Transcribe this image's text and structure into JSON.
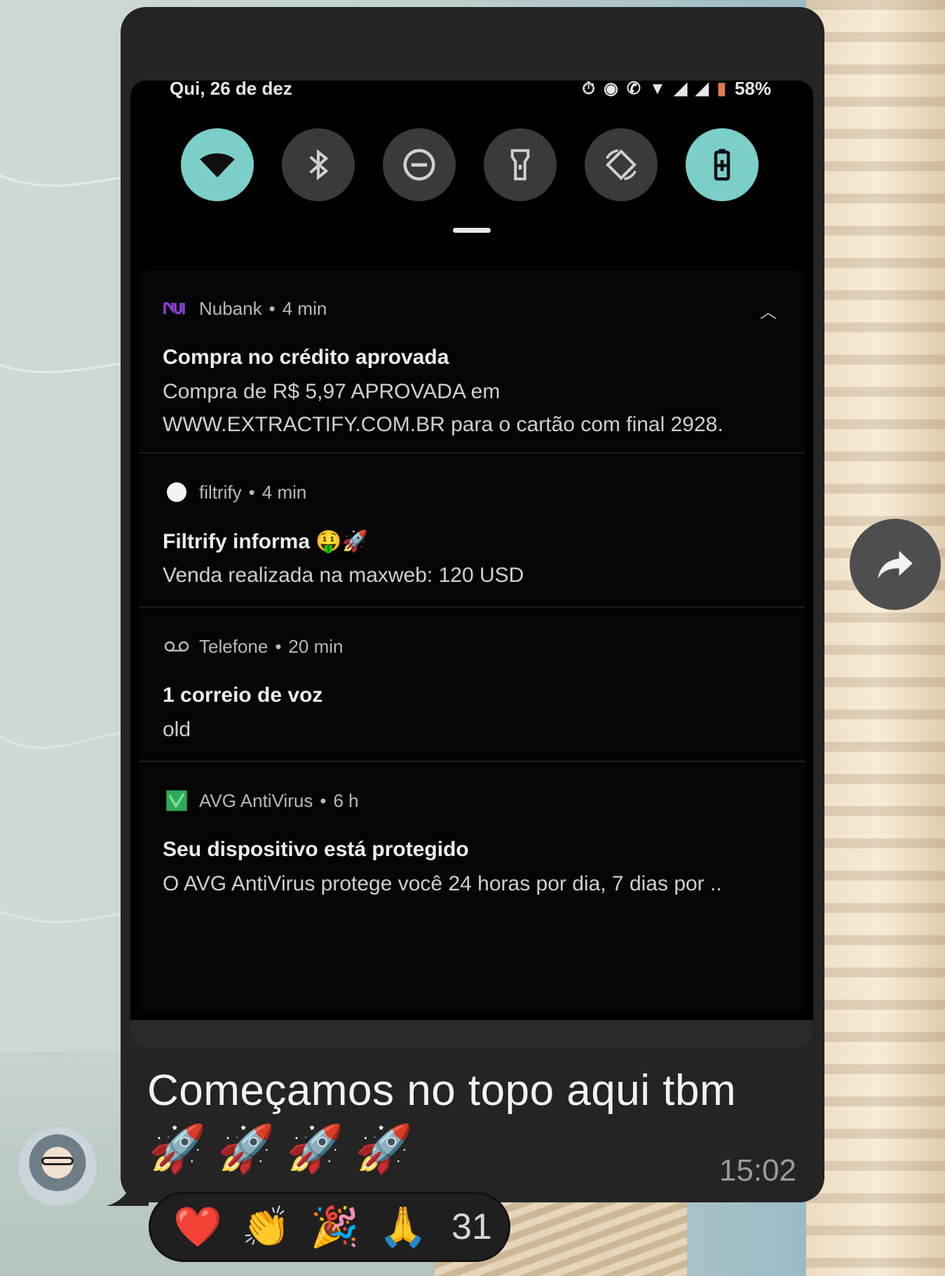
{
  "status_bar": {
    "date": "Qui, 26 de dez",
    "battery": "58%"
  },
  "quick_settings": {
    "tiles": [
      {
        "icon": "wifi-icon",
        "active": true
      },
      {
        "icon": "bluetooth-icon",
        "active": false
      },
      {
        "icon": "do-not-disturb-icon",
        "active": false
      },
      {
        "icon": "flashlight-icon",
        "active": false
      },
      {
        "icon": "auto-rotate-icon",
        "active": false
      },
      {
        "icon": "battery-saver-icon",
        "active": true
      }
    ]
  },
  "notifications": [
    {
      "app": "Nubank",
      "time": "4 min",
      "title": "Compra no crédito aprovada",
      "line1": "Compra de R$ 5,97 APROVADA em",
      "line2": "WWW.EXTRACTIFY.COM.BR para o cartão com final 2928."
    },
    {
      "app": "filtrify",
      "time": "4 min",
      "title": "Filtrify informa 🤑🚀",
      "line1": "Venda realizada na maxweb: 120 USD"
    },
    {
      "app": "Telefone",
      "time": "20 min",
      "title": "1 correio de voz",
      "line1": "old"
    },
    {
      "app": "AVG AntiVirus",
      "time": "6 h",
      "title": "Seu dispositivo está protegido",
      "line1": "O AVG AntiVirus protege você 24 horas por dia, 7 dias por .."
    }
  ],
  "message": {
    "text": "Começamos no topo aqui tbm",
    "emoji": "🚀🚀🚀🚀",
    "time": "15:02"
  },
  "reactions": {
    "emojis": [
      "❤️",
      "👏",
      "🎉",
      "🙏"
    ],
    "count": "31"
  },
  "colors": {
    "accent": "#7ccfc9",
    "bubble": "#242424",
    "panel": "#050505"
  }
}
